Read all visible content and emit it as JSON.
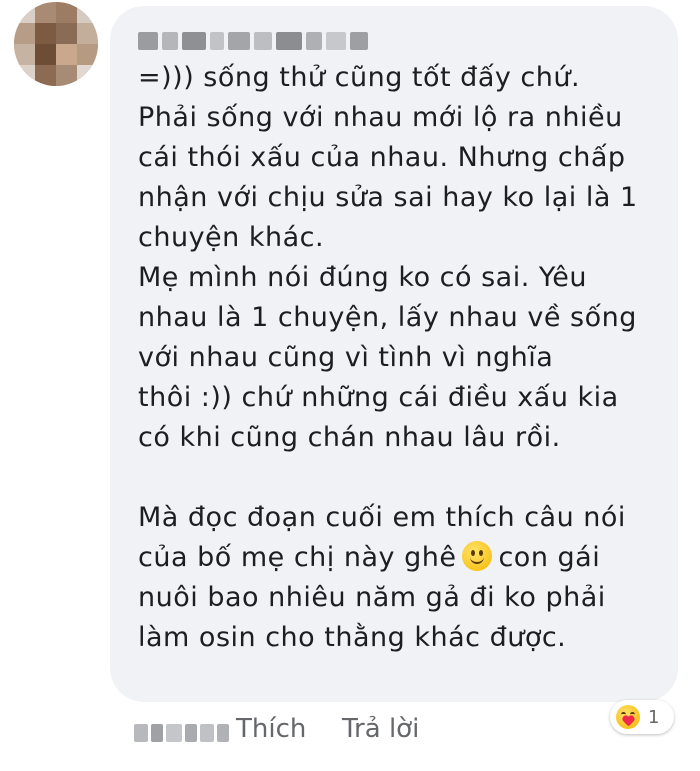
{
  "comment": {
    "lines_part1": [
      "=))) sống thử cũng tốt đấy chứ.",
      "Phải sống với nhau mới lộ ra nhiều",
      "cái thói xấu của nhau. Nhưng chấp",
      "nhận với chịu sửa sai hay ko lại là 1",
      "chuyện khác.",
      "Mẹ mình nói đúng ko có sai. Yêu",
      "nhau là 1 chuyện, lấy nhau về sống",
      "với nhau cũng vì tình vì nghĩa",
      "thôi :)) chứ những cái điều xấu kia",
      "có khi cũng chán nhau lâu rồi."
    ],
    "line_11": "Mà đọc đoạn cuối em thích câu nói",
    "line_12_before_emoji": "của bố mẹ chị  này ghê",
    "line_12_after_emoji": "con gái",
    "line_13": "nuôi bao nhiêu năm gả đi ko phải",
    "line_14": "làm osin cho thằng khác được.",
    "emoji_icon": "slightly-smiling-face-icon"
  },
  "actions": {
    "like_label": "Thích",
    "reply_label": "Trả lời"
  },
  "reaction": {
    "icon": "care-reaction-icon",
    "count": "1"
  },
  "colors": {
    "bubble": "#f0f2f5",
    "text": "#1c1e21",
    "action_text": "#65676b"
  }
}
